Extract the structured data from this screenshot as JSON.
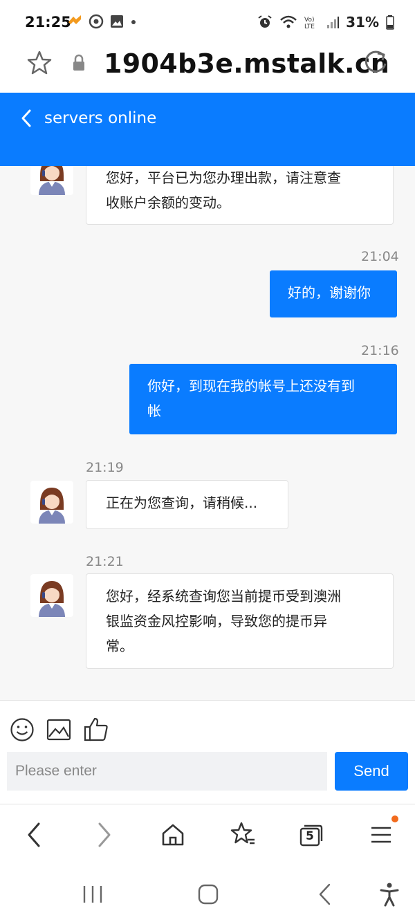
{
  "status": {
    "time": "21:25",
    "battery": "31%"
  },
  "browser": {
    "url": "1904b3e.mstalk.cn",
    "tab_count": "5"
  },
  "header": {
    "title": "servers online"
  },
  "messages": [
    {
      "side": "in",
      "text_l1": "您好，平台已为您办理出款，请注意查",
      "text_l2": "收账户余额的变动。"
    },
    {
      "side": "out",
      "time": "21:04",
      "text": "好的，谢谢你"
    },
    {
      "side": "out",
      "time": "21:16",
      "text_l1": "你好，到现在我的帐号上还没有到",
      "text_l2": "帐"
    },
    {
      "side": "in",
      "time": "21:19",
      "text": "正在为您查询，请稍候..."
    },
    {
      "side": "in",
      "time": "21:21",
      "text_l1": "您好，经系统查询您当前提币受到澳洲",
      "text_l2": "银监资金风控影响，导致您的提币异",
      "text_l3": "常。"
    }
  ],
  "composer": {
    "placeholder": "Please enter",
    "send_label": "Send"
  },
  "colors": {
    "accent": "#0a7cff",
    "chat_bg": "#f7f7f7"
  }
}
